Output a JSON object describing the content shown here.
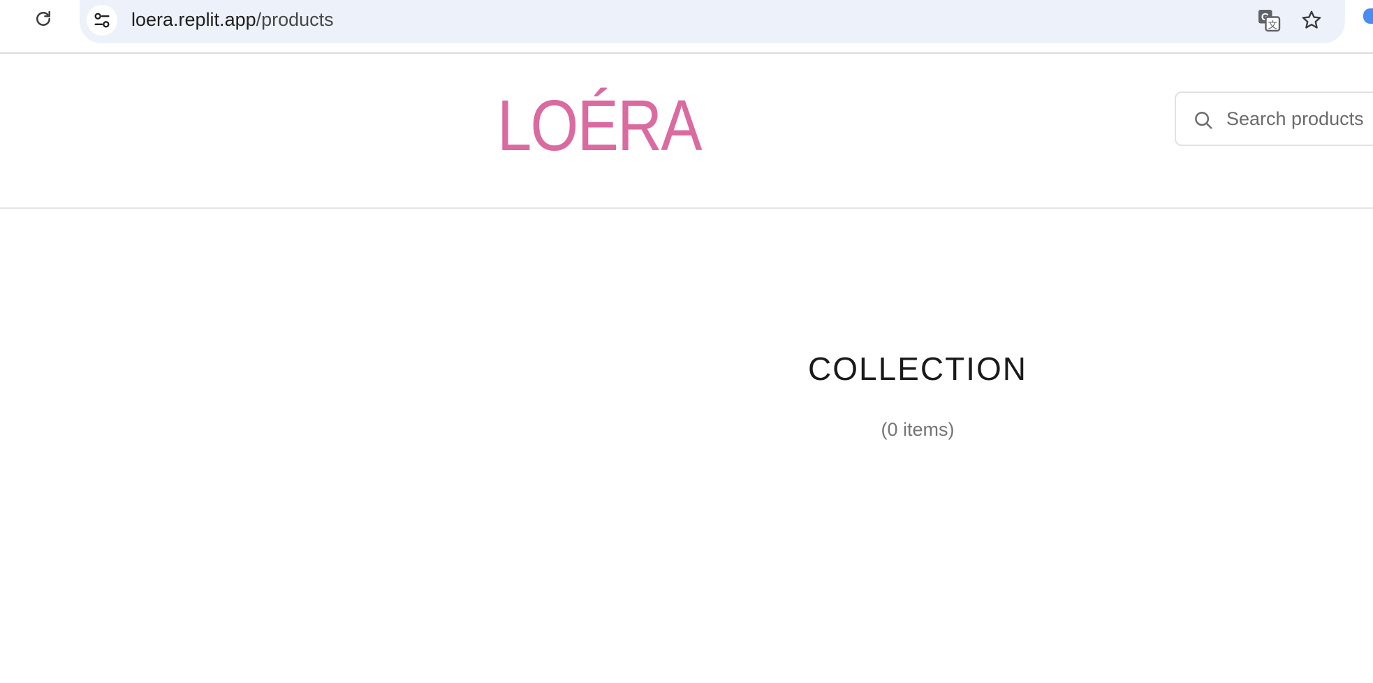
{
  "browser": {
    "url_host": "loera.replit.app",
    "url_path": "/products",
    "icons": {
      "reload": "reload-icon",
      "site_info": "tune-icon",
      "translate": "translate-icon",
      "bookmark": "star-icon"
    }
  },
  "header": {
    "logo": "LOÉRA",
    "logo_color": "#da6aa0",
    "search": {
      "placeholder": "Search products",
      "value": ""
    }
  },
  "main": {
    "title": "COLLECTION",
    "count": "(0 items)"
  }
}
